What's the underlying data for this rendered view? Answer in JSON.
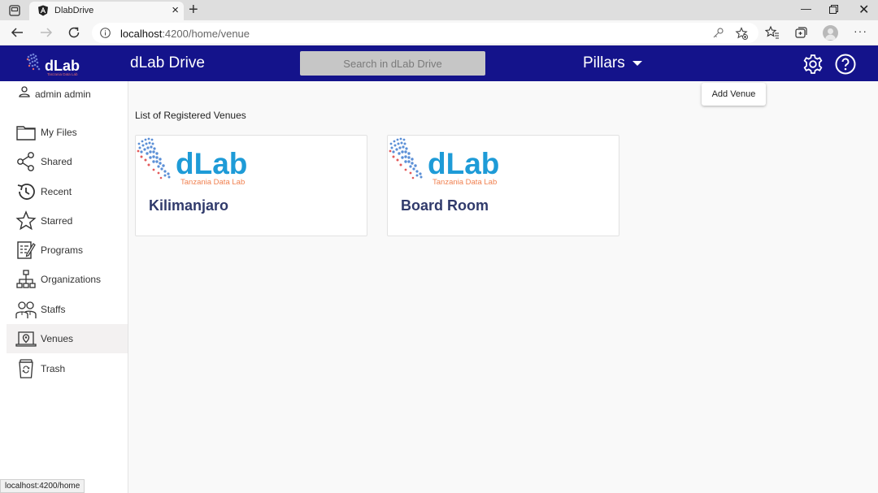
{
  "browser": {
    "tab_title": "DlabDrive",
    "url_host": "localhost",
    "url_rest": ":4200/home/venue",
    "status_url": "localhost:4200/home"
  },
  "header": {
    "app_title": "dLab Drive",
    "search_placeholder": "Search in dLab Drive",
    "menu_label": "Pillars",
    "logo_text": "dLab",
    "logo_sub": "Tanzania Data Lab",
    "brand_color": "#14138b"
  },
  "sidebar": {
    "user": "admin admin",
    "items": [
      {
        "label": "My Files",
        "icon": "folder-icon"
      },
      {
        "label": "Shared",
        "icon": "share-icon"
      },
      {
        "label": "Recent",
        "icon": "history-icon"
      },
      {
        "label": "Starred",
        "icon": "star-icon"
      },
      {
        "label": "Programs",
        "icon": "program-icon"
      },
      {
        "label": "Organizations",
        "icon": "org-chart-icon"
      },
      {
        "label": "Staffs",
        "icon": "staff-icon"
      },
      {
        "label": "Venues",
        "icon": "venue-icon",
        "active": true
      },
      {
        "label": "Trash",
        "icon": "trash-icon"
      }
    ]
  },
  "main": {
    "add_button": "Add Venue",
    "list_title": "List of Registered Venues",
    "venues": [
      {
        "name": "Kilimanjaro",
        "logo_text": "dLab",
        "logo_sub": "Tanzania Data Lab"
      },
      {
        "name": "Board Room",
        "logo_text": "dLab",
        "logo_sub": "Tanzania Data Lab"
      }
    ]
  }
}
